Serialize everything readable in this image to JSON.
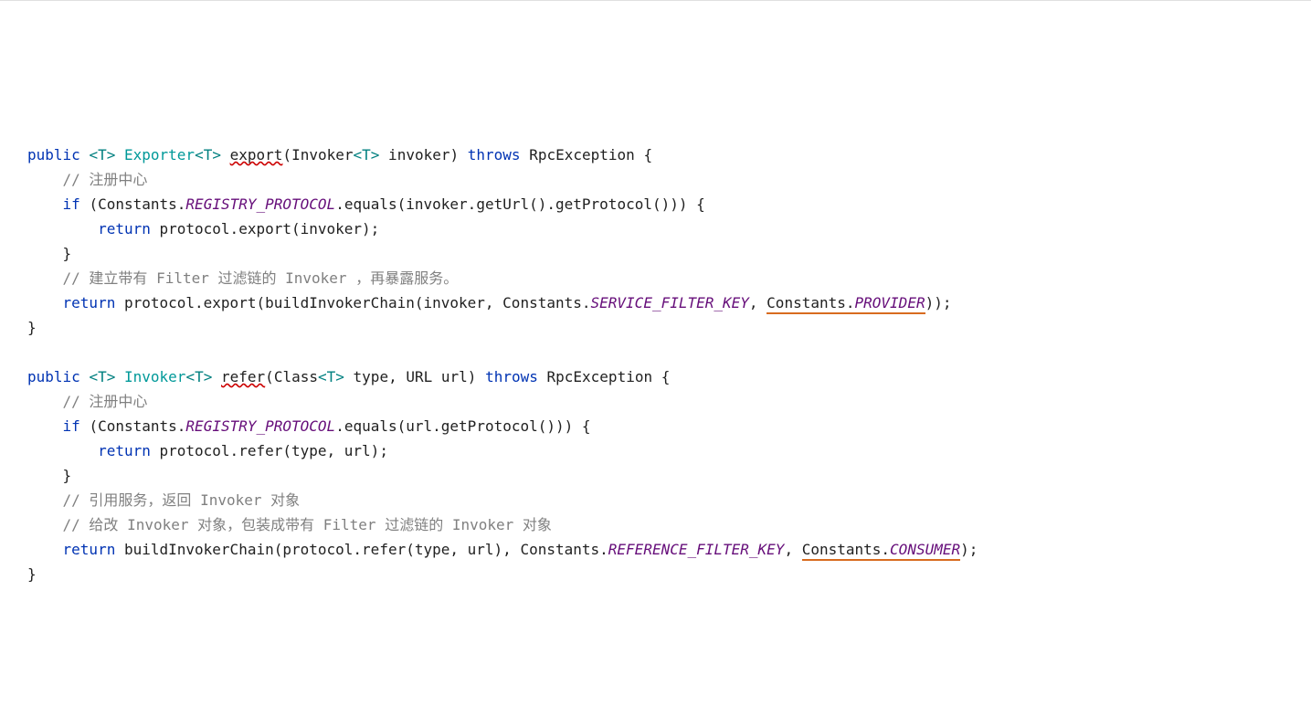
{
  "m1": {
    "kw_public": "public",
    "lt1": "<",
    "tp": "T",
    "gt1": ">",
    "ret": "Exporter",
    "ret_lt": "<",
    "ret_tp": "T",
    "ret_gt": ">",
    "name": "export",
    "lp": "(",
    "ptype": "Invoker",
    "plt": "<",
    "ptp": "T",
    "pgt": ">",
    "pname": " invoker",
    "rp": ")",
    "kw_throws": "throws",
    "exc": "RpcException",
    "ob": "{",
    "c1": "// 注册中心",
    "kw_if": "if",
    "if_lp": "(",
    "cls": "Constants",
    "dot": ".",
    "fld": "REGISTRY_PROTOCOL",
    "rest_if": ".equals(invoker.getUrl().getProtocol())) {",
    "kw_return1": "return",
    "ret1_rest": " protocol.export(invoker);",
    "cb_if": "}",
    "c2": "// 建立带有 Filter 过滤链的 Invoker ，再暴露服务。",
    "kw_return2": "return",
    "ret2_a": " protocol.export(buildInvokerChain(invoker, ",
    "ret2_c1": "Constants",
    "ret2_d1": ".",
    "ret2_f1": "SERVICE_FILTER_KEY",
    "ret2_sep": ", ",
    "ret2_c2": "Constants",
    "ret2_d2": ".",
    "ret2_f2": "PROVIDER",
    "ret2_end": "));",
    "cb": "}"
  },
  "m2": {
    "kw_public": "public",
    "lt1": "<",
    "tp": "T",
    "gt1": ">",
    "ret": "Invoker",
    "ret_lt": "<",
    "ret_tp": "T",
    "ret_gt": ">",
    "name": "refer",
    "lp": "(",
    "p1type": "Class",
    "p1lt": "<",
    "p1tp": "T",
    "p1gt": ">",
    "p1name": " type",
    "comma": ", ",
    "p2type": "URL",
    "p2name": " url",
    "rp": ")",
    "kw_throws": "throws",
    "exc": "RpcException",
    "ob": "{",
    "c1": "// 注册中心",
    "kw_if": "if",
    "if_lp": "(",
    "cls": "Constants",
    "dot": ".",
    "fld": "REGISTRY_PROTOCOL",
    "rest_if": ".equals(url.getProtocol())) {",
    "kw_return1": "return",
    "ret1_rest": " protocol.refer(type, url);",
    "cb_if": "}",
    "c2": "// 引用服务，返回 Invoker 对象",
    "c3": "// 给改 Invoker 对象，包装成带有 Filter 过滤链的 Invoker 对象",
    "kw_return2": "return",
    "ret2_a": " buildInvokerChain(protocol.refer(type, url), ",
    "ret2_c1": "Constants",
    "ret2_d1": ".",
    "ret2_f1": "REFERENCE_FILTER_KEY",
    "ret2_sep": ", ",
    "ret2_c2": "Constants",
    "ret2_d2": ".",
    "ret2_f2": "CONSUMER",
    "ret2_end": ");",
    "cb": "}"
  }
}
